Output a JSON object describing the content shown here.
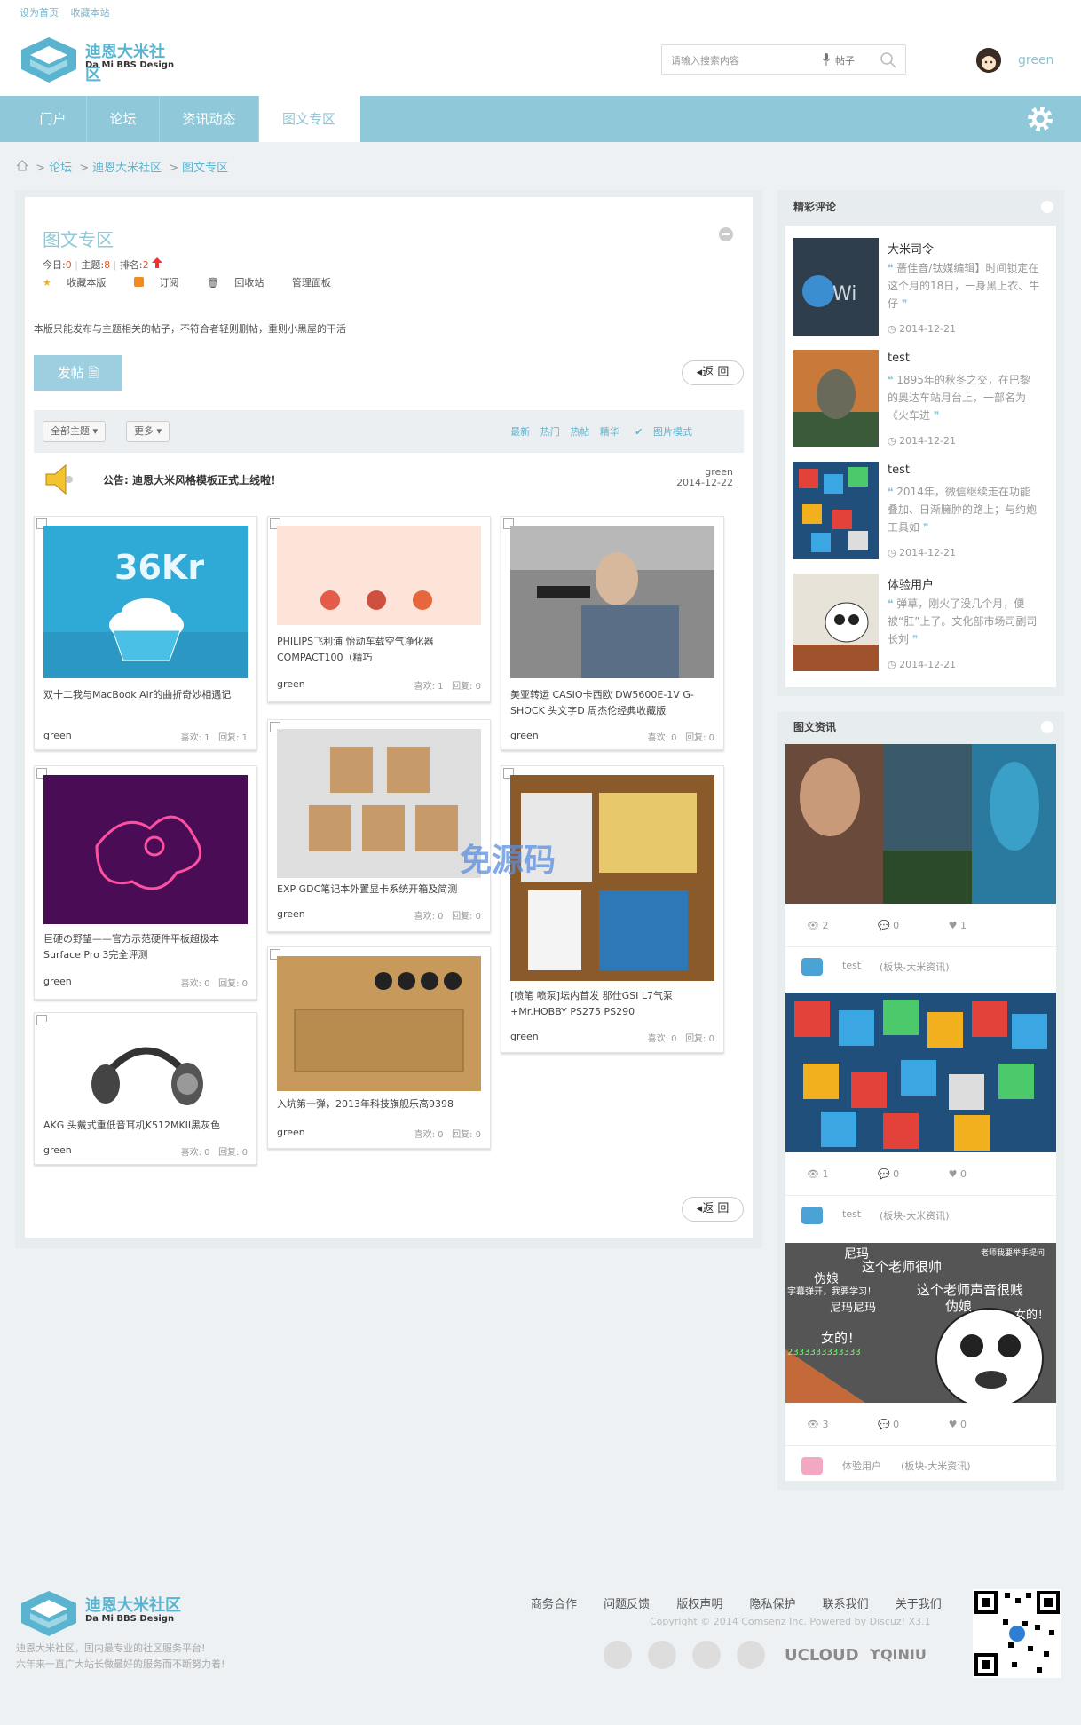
{
  "toplinks": {
    "home": "设为首页",
    "fav": "收藏本站"
  },
  "brand": {
    "name": "迪恩大米社区",
    "sub": "Da Mi BBS Design"
  },
  "search": {
    "placeholder": "请输入搜索内容",
    "type": "帖子"
  },
  "user": {
    "name": "green"
  },
  "nav": [
    {
      "label": "门户"
    },
    {
      "label": "论坛"
    },
    {
      "label": "资讯动态"
    },
    {
      "label": "图文专区"
    }
  ],
  "breadcrumb": {
    "items": [
      "论坛",
      "迪恩大米社区",
      "图文专区"
    ]
  },
  "forum": {
    "title": "图文专区",
    "today_label": "今日:",
    "today": "0",
    "topics_label": "主题:",
    "topics": "8",
    "rank_label": "排名:",
    "rank": "2",
    "actions": [
      "收藏本版",
      "订阅",
      "回收站",
      "管理面板"
    ],
    "desc": "本版只能发布与主题相关的帖子，不符合者轻则删帖，重则小黑屋的干活",
    "post_btn": "发帖",
    "back_btn": "返 回"
  },
  "filters": {
    "all": "全部主题",
    "more": "更多",
    "right": [
      "最新",
      "热门",
      "热帖",
      "精华"
    ],
    "pic_mode": "图片模式"
  },
  "notice": {
    "label": "公告:",
    "text": "迪恩大米风格模板正式上线啦！",
    "user": "green",
    "date": "2014-12-22"
  },
  "likes_label": "喜欢:",
  "replies_label": "回复:",
  "cards": [
    {
      "title": "双十二我与MacBook Air的曲折奇妙相遇记",
      "user": "green",
      "likes": "1",
      "replies": "1"
    },
    {
      "title": "巨硬の野望——官方示范硬件平板超极本Surface Pro 3完全评测",
      "user": "green",
      "likes": "0",
      "replies": "0"
    },
    {
      "title": "AKG 头戴式重低音耳机K512MKII黑灰色",
      "user": "green",
      "likes": "0",
      "replies": "0"
    },
    {
      "title": "PHILIPS飞利浦 怡动车载空气净化器COMPACT100（精巧",
      "user": "green",
      "likes": "1",
      "replies": "0"
    },
    {
      "title": "EXP GDC笔记本外置显卡系统开箱及简测",
      "user": "green",
      "likes": "0",
      "replies": "0"
    },
    {
      "title": "入坑第一弹，2013年科技旗舰乐高9398",
      "user": "green",
      "likes": "0",
      "replies": "0"
    },
    {
      "title": "美亚转运 CASIO卡西欧 DW5600E-1V G-SHOCK 头文字D 周杰伦经典收藏版",
      "user": "green",
      "likes": "0",
      "replies": "0"
    },
    {
      "title": "[喷笔 喷泵]坛内首发 郡仕GSI L7气泵+Mr.HOBBY PS275 PS290",
      "user": "green",
      "likes": "0",
      "replies": "0"
    }
  ],
  "comments": {
    "title": "精彩评论",
    "items": [
      {
        "name": "大米司令",
        "quote": "蔷佳音/钛媒编辑】时间锁定在这个月的18日，一身黑上衣、牛仔",
        "date": "2014-12-21"
      },
      {
        "name": "test",
        "quote": "1895年的秋冬之交，在巴黎的奥达车站月台上，一部名为《火车进",
        "date": "2014-12-21"
      },
      {
        "name": "test",
        "quote": "2014年，微信继续走在功能叠加、日渐臃肿的路上；与约炮工具如",
        "date": "2014-12-21"
      },
      {
        "name": "体验用户",
        "quote": "弹草，刚火了没几个月，便被“肛”上了。文化部市场司副司长刘",
        "date": "2014-12-21"
      }
    ]
  },
  "news": {
    "title": "图文资讯",
    "items": [
      {
        "views": "2",
        "comments": "0",
        "likes": "1",
        "user": "test",
        "board": "(板块-大米资讯)"
      },
      {
        "views": "1",
        "comments": "0",
        "likes": "0",
        "user": "test",
        "board": "(板块-大米资讯)"
      },
      {
        "views": "3",
        "comments": "0",
        "likes": "0",
        "user": "体验用户",
        "board": "(板块-大米资讯)"
      }
    ]
  },
  "meme": {
    "lines": [
      "尼玛",
      "这个老师很帅",
      "伪娘",
      "这个老师声音很贱",
      "尼玛尼玛",
      "伪娘",
      "女的！",
      "女的！",
      "老师我要举手提问",
      "字幕弹开，我要学习！",
      "2333333333333"
    ]
  },
  "footer": {
    "links": [
      "商务合作",
      "问题反馈",
      "版权声明",
      "隐私保护",
      "联系我们",
      "关于我们"
    ],
    "copyright": "Copyright © 2014 Comsenz Inc. Powered by Discuz! X3.1",
    "text1": "迪恩大米社区，国内最专业的社区服务平台!",
    "text2": "六年来一直广大站长做最好的服务而不断努力着!",
    "brands": [
      "UCLOUD",
      "QINIU"
    ]
  },
  "watermark": "免源码",
  "colors": {
    "accent": "#8ec8d9",
    "link": "#5ab4d0",
    "stat": "#e35a2a"
  }
}
